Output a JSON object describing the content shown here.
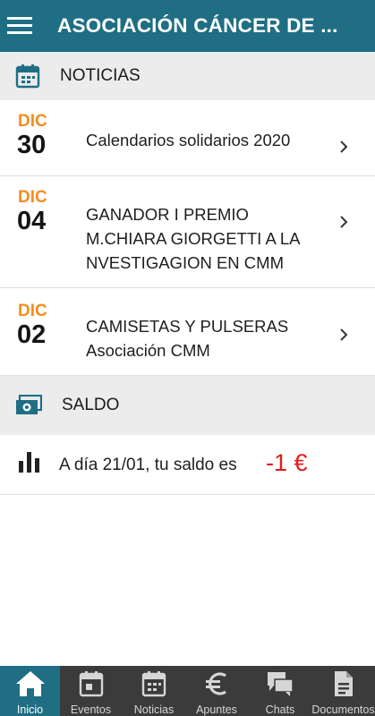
{
  "app": {
    "title": "ASOCIACIÓN CÁNCER DE ..."
  },
  "sections": {
    "news": {
      "label": "NOTICIAS",
      "icon": "calendar-icon"
    },
    "balance": {
      "label": "SALDO",
      "icon": "money-icon"
    }
  },
  "news_items": [
    {
      "month": "DIC",
      "day": "30",
      "title": "Calendarios solidarios 2020"
    },
    {
      "month": "DIC",
      "day": "04",
      "title": "GANADOR I PREMIO M.CHIARA GIORGETTI A LA NVESTIGAGION EN CMM"
    },
    {
      "month": "DIC",
      "day": "02",
      "title": "CAMISETAS Y PULSERAS Asociación CMM"
    }
  ],
  "balance": {
    "text": "A día 21/01, tu saldo es",
    "amount": "-1 €",
    "icon": "bar-chart-icon"
  },
  "bottom_nav": [
    {
      "label": "Inicio",
      "icon": "home-icon",
      "active": true
    },
    {
      "label": "Eventos",
      "icon": "event-icon"
    },
    {
      "label": "Noticias",
      "icon": "calendar-icon"
    },
    {
      "label": "Apuntes",
      "icon": "euro-icon"
    },
    {
      "label": "Chats",
      "icon": "chat-icon"
    },
    {
      "label": "Documentos",
      "icon": "document-icon"
    }
  ],
  "colors": {
    "primary": "#1f6e84",
    "accent_date": "#f58d1e",
    "negative_amount": "#e41b1b",
    "section_bg": "#ececec",
    "nav_bg": "#3b3b3b"
  }
}
